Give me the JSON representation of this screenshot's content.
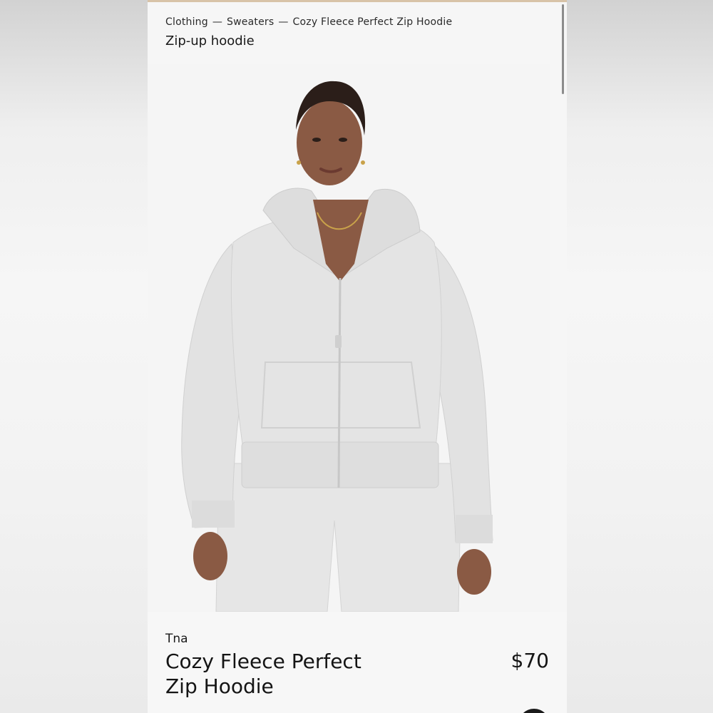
{
  "breadcrumb": {
    "items": [
      "Clothing",
      "Sweaters",
      "Cozy Fleece Perfect Zip Hoodie"
    ],
    "separator": "—"
  },
  "category_title": "Zip-up hoodie",
  "product": {
    "brand": "Tna",
    "name": "Cozy Fleece Perfect Zip Hoodie",
    "price": "$70",
    "image": "product-photo"
  },
  "colors": {
    "accent": "#d8c3a8",
    "text": "#1a1a1a",
    "hoodie": "#e3e3e3",
    "skin": "#8a5a44"
  }
}
